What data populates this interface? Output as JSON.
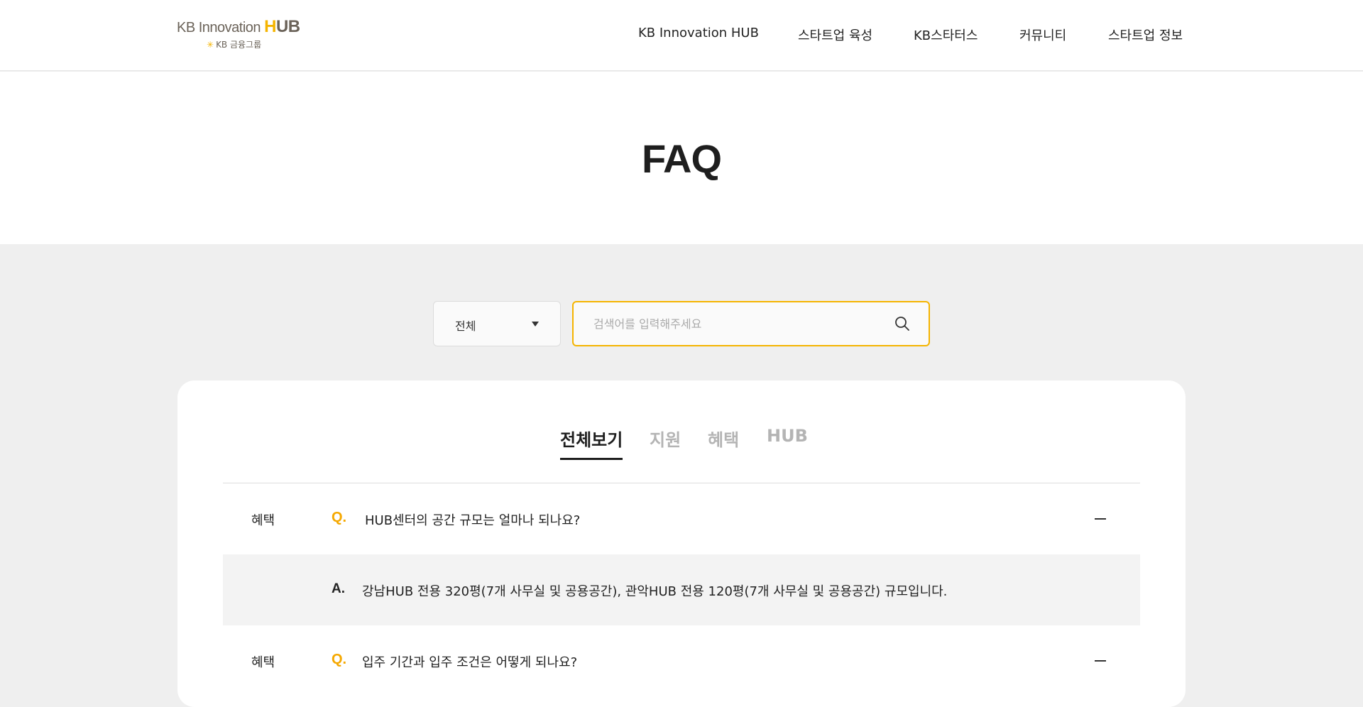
{
  "header": {
    "logo_main": "KB Innovation",
    "logo_hub_h": "H",
    "logo_hub_rest": "UB",
    "logo_sub": "KB 금융그룹",
    "logo_star": "✳"
  },
  "nav": {
    "items": [
      "KB Innovation HUB",
      "스타트업 육성",
      "KB스타터스",
      "커뮤니티",
      "스타트업 정보"
    ]
  },
  "hero": {
    "title": "FAQ"
  },
  "filter": {
    "selected": "전체",
    "search_placeholder": "검색어를 입력해주세요",
    "search_value": ""
  },
  "tabs": [
    "전체보기",
    "지원",
    "혜택",
    "HUB"
  ],
  "faq": [
    {
      "category": "혜택",
      "q_mark": "Q.",
      "question": "HUB센터의 공간 규모는 얼마나 되나요?",
      "a_mark": "A.",
      "answer": "강남HUB 전용 320평(7개 사무실 및 공용공간), 관악HUB 전용 120평(7개 사무실 및 공용공간) 규모입니다."
    },
    {
      "category": "혜택",
      "q_mark": "Q.",
      "question": "입주 기간과 입주 조건은 어떻게 되나요?"
    }
  ],
  "colors": {
    "accent": "#f5b400",
    "background": "#efefef"
  }
}
